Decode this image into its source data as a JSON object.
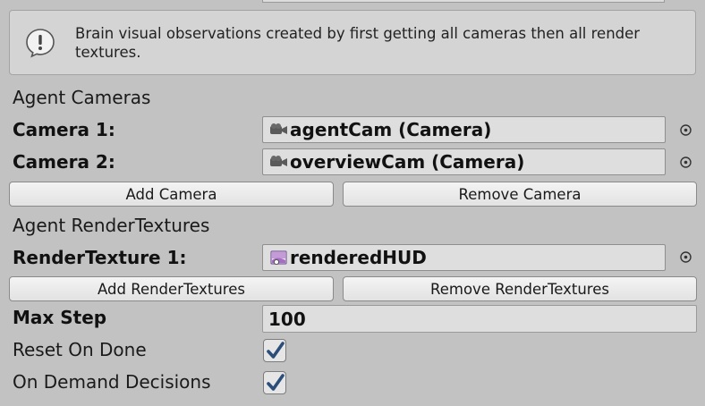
{
  "help": {
    "icon": "info-exclamation-icon",
    "text": "Brain visual observations created by first getting all cameras then all render textures."
  },
  "cameras": {
    "section_label": "Agent Cameras",
    "items": [
      {
        "label": "Camera 1:",
        "value": "agentCam (Camera)",
        "icon": "camera-icon"
      },
      {
        "label": "Camera 2:",
        "value": "overviewCam (Camera)",
        "icon": "camera-icon"
      }
    ],
    "add_label": "Add Camera",
    "remove_label": "Remove Camera"
  },
  "render_textures": {
    "section_label": "Agent RenderTextures",
    "items": [
      {
        "label": "RenderTexture 1:",
        "value": "renderedHUD",
        "icon": "render-texture-icon"
      }
    ],
    "add_label": "Add RenderTextures",
    "remove_label": "Remove RenderTextures"
  },
  "max_step": {
    "label": "Max Step",
    "value": "100"
  },
  "reset_on_done": {
    "label": "Reset On Done",
    "checked": true
  },
  "on_demand_decisions": {
    "label": "On Demand Decisions",
    "checked": true
  },
  "colors": {
    "background": "#c2c2c2",
    "checkmark": "#2b4d7a"
  }
}
